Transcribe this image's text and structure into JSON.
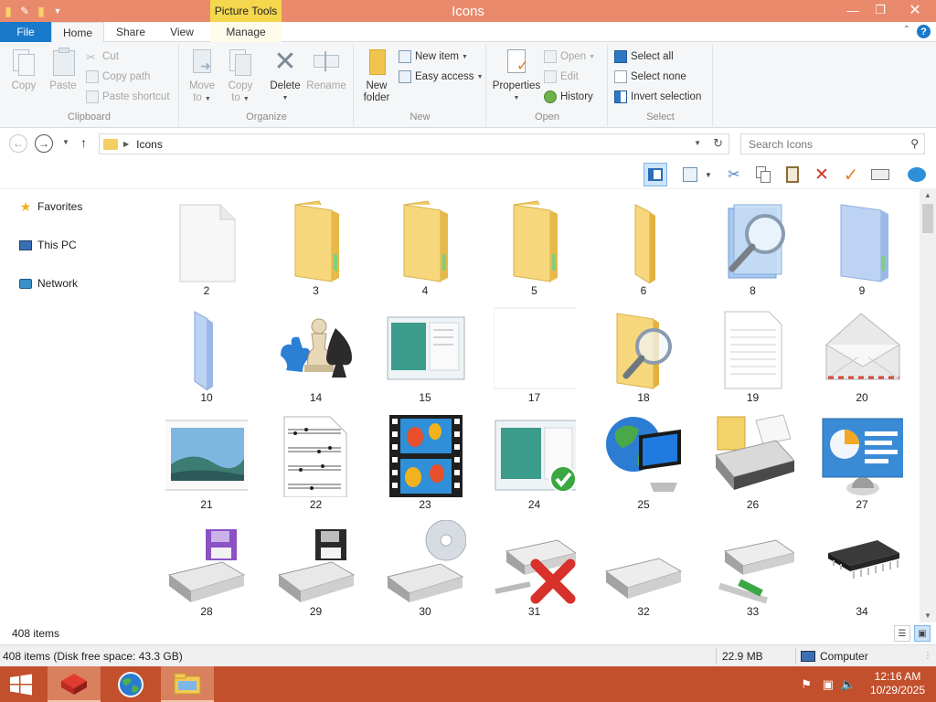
{
  "window": {
    "title": "Icons",
    "context_tab_group": "Picture Tools"
  },
  "ribbon_tabs": {
    "file": "File",
    "home": "Home",
    "share": "Share",
    "view": "View",
    "manage": "Manage"
  },
  "ribbon": {
    "clipboard": {
      "label": "Clipboard",
      "copy": "Copy",
      "paste": "Paste",
      "cut": "Cut",
      "copy_path": "Copy path",
      "paste_shortcut": "Paste shortcut"
    },
    "organize": {
      "label": "Organize",
      "move_to": "Move to",
      "copy_to": "Copy to",
      "delete": "Delete",
      "rename": "Rename"
    },
    "new": {
      "label": "New",
      "new_folder": "New folder",
      "new_item": "New item",
      "easy_access": "Easy access"
    },
    "open": {
      "label": "Open",
      "properties": "Properties",
      "open": "Open",
      "edit": "Edit",
      "history": "History"
    },
    "select": {
      "label": "Select",
      "select_all": "Select all",
      "select_none": "Select none",
      "invert_selection": "Invert selection"
    }
  },
  "address": {
    "path": "Icons",
    "search_placeholder": "Search Icons"
  },
  "nav": {
    "favorites": "Favorites",
    "this_pc": "This PC",
    "network": "Network"
  },
  "items": [
    {
      "label": "2",
      "icon": "blank-file-icon"
    },
    {
      "label": "3",
      "icon": "folder-icon"
    },
    {
      "label": "4",
      "icon": "folder-icon"
    },
    {
      "label": "5",
      "icon": "folder-icon"
    },
    {
      "label": "6",
      "icon": "folder-side-icon"
    },
    {
      "label": "8",
      "icon": "search-folder-icon"
    },
    {
      "label": "9",
      "icon": "blue-folder-icon"
    },
    {
      "label": "10",
      "icon": "blue-folder-side-icon"
    },
    {
      "label": "14",
      "icon": "games-icon"
    },
    {
      "label": "15",
      "icon": "window-preview-icon"
    },
    {
      "label": "17",
      "icon": "blank-frame-icon"
    },
    {
      "label": "18",
      "icon": "folder-search-icon"
    },
    {
      "label": "19",
      "icon": "text-document-icon"
    },
    {
      "label": "20",
      "icon": "envelope-icon"
    },
    {
      "label": "21",
      "icon": "picture-icon"
    },
    {
      "label": "22",
      "icon": "music-sheet-icon"
    },
    {
      "label": "23",
      "icon": "video-film-icon"
    },
    {
      "label": "24",
      "icon": "window-check-icon"
    },
    {
      "label": "25",
      "icon": "network-globe-icon"
    },
    {
      "label": "26",
      "icon": "printer-icon"
    },
    {
      "label": "27",
      "icon": "control-panel-icon"
    },
    {
      "label": "28",
      "icon": "floppy-drive-purple-icon"
    },
    {
      "label": "29",
      "icon": "floppy-drive-black-icon"
    },
    {
      "label": "30",
      "icon": "cd-drive-icon"
    },
    {
      "label": "31",
      "icon": "network-drive-disconnected-icon"
    },
    {
      "label": "32",
      "icon": "hard-drive-icon"
    },
    {
      "label": "33",
      "icon": "network-drive-icon"
    },
    {
      "label": "34",
      "icon": "memory-chip-icon"
    }
  ],
  "status": {
    "item_count": "408 items",
    "details": "408 items (Disk free space: 43.3 GB)",
    "size": "22.9 MB",
    "location": "Computer"
  },
  "taskbar": {
    "time": "12:16 AM",
    "date": "10/29/2025"
  },
  "colors": {
    "title_bar": "#e98a6c",
    "file_tab": "#1979ca",
    "context_tab": "#f4d74d",
    "taskbar": "#c2502c"
  }
}
